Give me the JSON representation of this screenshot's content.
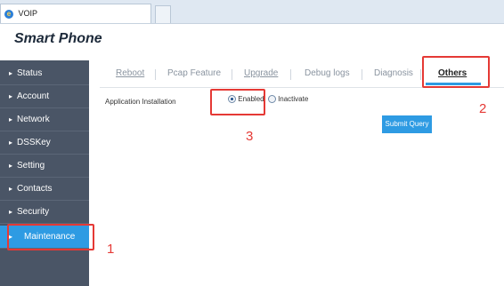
{
  "browser": {
    "tab_title": "VOIP"
  },
  "app": {
    "logo_text": "Smart Phone"
  },
  "sidebar": {
    "items": [
      {
        "label": "Status"
      },
      {
        "label": "Account"
      },
      {
        "label": "Network"
      },
      {
        "label": "DSSKey"
      },
      {
        "label": "Setting"
      },
      {
        "label": "Contacts"
      },
      {
        "label": "Security"
      },
      {
        "label": "Maintenance"
      }
    ]
  },
  "tabs": {
    "items": [
      {
        "label": "Reboot"
      },
      {
        "label": "Pcap Feature"
      },
      {
        "label": "Upgrade"
      },
      {
        "label": "Debug logs"
      },
      {
        "label": "Diagnosis"
      },
      {
        "label": "Others"
      }
    ]
  },
  "form": {
    "app_install_label": "Application Installation",
    "option_enabled": "Enabled",
    "option_inactivate": "Inactivate",
    "selected": "Enabled",
    "submit_label": "Submit Query"
  },
  "annotations": {
    "one": "1",
    "two": "2",
    "three": "3"
  },
  "colors": {
    "sidebar_bg": "#4a5566",
    "accent": "#2e9be3",
    "callout": "#e53935"
  }
}
